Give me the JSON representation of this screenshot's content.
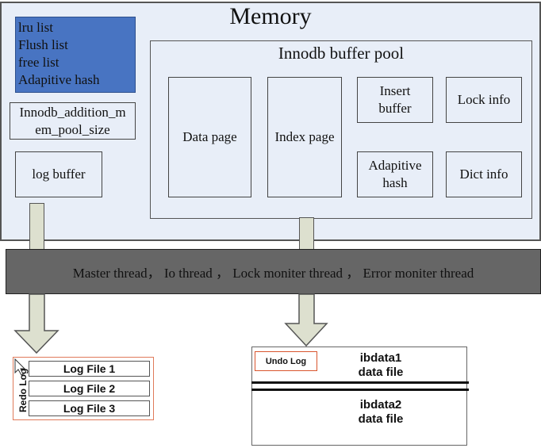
{
  "memory": {
    "title": "Memory",
    "lists_box": [
      "lru list",
      "Flush list",
      "free list",
      "Adapitive hash"
    ],
    "addition_pool": [
      "Innodb_addition_m",
      "em_pool_size"
    ],
    "log_buffer": "log buffer"
  },
  "buffer_pool": {
    "title": "Innodb buffer pool",
    "data_page": "Data page",
    "index_page": "Index page",
    "insert_buffer": [
      "Insert",
      "buffer"
    ],
    "lock_info": "Lock info",
    "adaptive_hash": [
      "Adapitive",
      "hash"
    ],
    "dict_info": "Dict info"
  },
  "threads": {
    "label": "Master thread， Io thread ， Lock moniter thread ， Error moniter thread"
  },
  "redo": {
    "label": "Redo Log",
    "files": [
      "Log File 1",
      "Log File 2",
      "Log File 3"
    ]
  },
  "ibdata": {
    "undo_label": "Undo Log",
    "file1": [
      "ibdata1",
      "data file"
    ],
    "file2": [
      "ibdata2",
      "data file"
    ]
  },
  "colors": {
    "memory_bg": "#e8eef8",
    "lists_box_bg": "#4874c2",
    "thread_band_bg": "#666666",
    "arrow_fill": "#dde0cf",
    "redo_frame_border": "#e07a5a",
    "undo_arrow": "#d9552e"
  }
}
